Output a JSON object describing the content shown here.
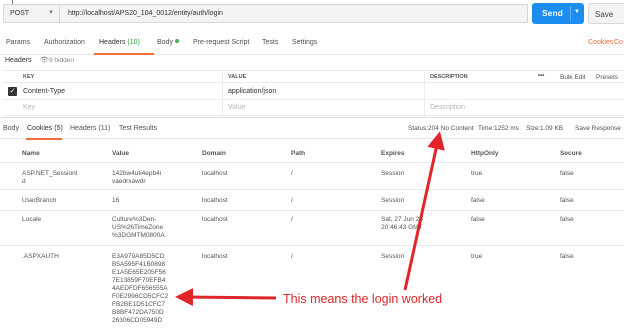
{
  "request": {
    "method": "POST",
    "url": "http://localhost/APS20_104_0012/entity/auth/login",
    "send_label": "Send",
    "save_label": "Save"
  },
  "request_tabs": {
    "params": "Params",
    "authorization": "Authorization",
    "headers": "Headers",
    "headers_count": "(10)",
    "body": "Body",
    "prerequest": "Pre-request Script",
    "tests": "Tests",
    "settings": "Settings",
    "cookies_link": "Cookies",
    "code_link": "Co"
  },
  "headers_section": {
    "title": "Headers",
    "hidden": "9 hidden",
    "col_key": "KEY",
    "col_value": "VALUE",
    "col_description": "DESCRIPTION",
    "more": "•••",
    "bulk_edit": "Bulk Edit",
    "presets": "Presets",
    "rows": [
      {
        "key": "Content-Type",
        "value": "application/json",
        "description": ""
      }
    ],
    "placeholder_key": "Key",
    "placeholder_value": "Value",
    "placeholder_description": "Description"
  },
  "response": {
    "tabs": {
      "body": "Body",
      "cookies": "Cookies (5)",
      "headers": "Headers (11)",
      "test_results": "Test Results"
    },
    "status_label": "Status:",
    "status_value": "204 No Content",
    "time_label": "Time:",
    "time_value": "1252 ms",
    "size_label": "Size:",
    "size_value": "1.09 KB",
    "save_response": "Save Response"
  },
  "cookies": {
    "columns": [
      "Name",
      "Value",
      "Domain",
      "Path",
      "Expires",
      "HttpOnly",
      "Secure"
    ],
    "rows": [
      {
        "name": [
          "ASP.NET_SessionI",
          "d"
        ],
        "value": [
          "142bw4uti4epb4i",
          "vaedrxawdr"
        ],
        "domain": "localhost",
        "path": "/",
        "expires": [
          "Session"
        ],
        "httponly": "true",
        "secure": "false"
      },
      {
        "name": [
          "UserBranch"
        ],
        "value": [
          "16"
        ],
        "domain": "localhost",
        "path": "/",
        "expires": [
          "Session"
        ],
        "httponly": "false",
        "secure": "false"
      },
      {
        "name": [
          "Locale"
        ],
        "value": [
          "Culture%3Den-",
          "US%26TimeZone",
          "%3DGMTM0800A"
        ],
        "domain": "localhost",
        "path": "/",
        "expires": [
          "Sat, 27 Jun 20",
          "20:46:43 GMT"
        ],
        "httponly": "false",
        "secure": "false"
      },
      {
        "name": [
          ".ASPXAUTH"
        ],
        "value": [
          "E3A979A85D5CD",
          "B5A595F41B0898",
          "E1A5E65E205F56",
          "7E13859F70EFB4",
          "4AEDFDF656555A",
          "F0E2996CD5CFC2",
          "FB2BE1D51CFC7",
          "B8BF472DA750D",
          "26306CD05949D"
        ],
        "domain": "localhost",
        "path": "/",
        "expires": [
          "Session"
        ],
        "httponly": "true",
        "secure": "false"
      }
    ]
  },
  "annotation": {
    "text": "This means the login worked",
    "color": "#e0262a"
  },
  "colors": {
    "send_blue": "#1b8ef0",
    "accent_orange": "#f26b3a",
    "status_green": "#2a9d3a"
  }
}
